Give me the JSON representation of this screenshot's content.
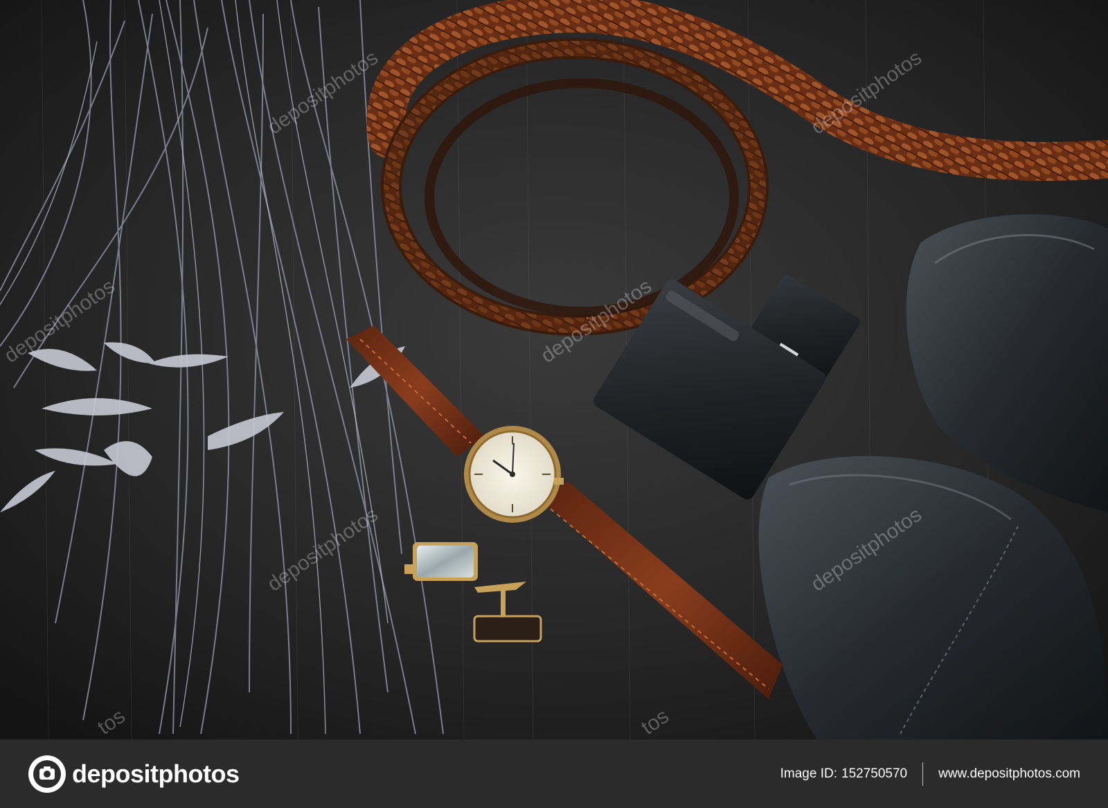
{
  "photo": {
    "watermark_text": "depositphotos",
    "watermark_partial": "tos",
    "description_objects": [
      "feathers",
      "braided-leather-belt",
      "perfume-bottle",
      "wristwatch",
      "cufflinks",
      "leather-shoes"
    ]
  },
  "footer": {
    "brand_name": "depositphotos",
    "image_id_label": "Image ID:",
    "image_id_value": "152750570",
    "website": "www.depositphotos.com"
  },
  "colors": {
    "background": "#1e1e1e",
    "footer_bg": "#2b2b2b",
    "leather_brown": "#7a3a1c",
    "gold": "#c9a25a"
  }
}
